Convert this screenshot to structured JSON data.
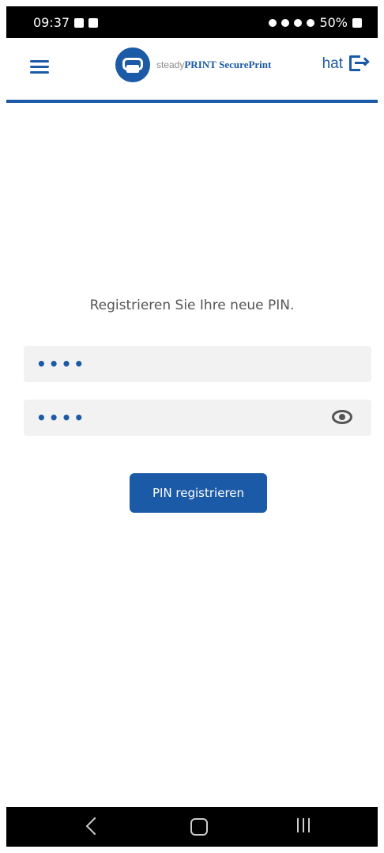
{
  "status_bar": {
    "time": "09:37",
    "battery": "50%"
  },
  "app_bar": {
    "logo_prefix": "steady",
    "logo_brand": "PRINT",
    "logo_product": "SecurePrint",
    "user_label": "hat"
  },
  "form": {
    "prompt": "Registrieren Sie Ihre neue PIN.",
    "pin_value": "••••",
    "pin_confirm_value": "••••",
    "submit_label": "PIN registrieren"
  },
  "colors": {
    "accent": "#1b5aa6",
    "field_background": "#f2f2f2"
  },
  "icons": [
    "menu-icon",
    "printer-logo-icon",
    "logout-icon",
    "eye-icon",
    "back-icon",
    "home-icon",
    "recent-apps-icon"
  ]
}
